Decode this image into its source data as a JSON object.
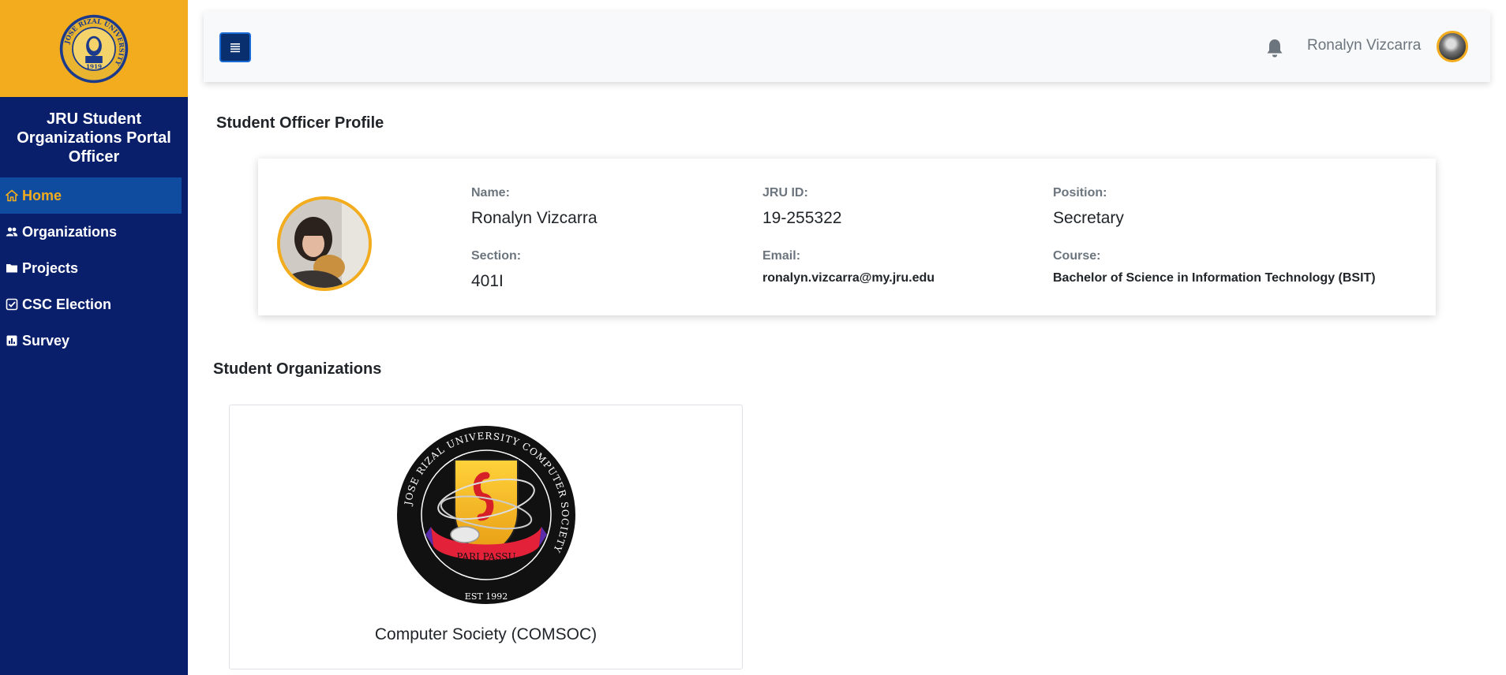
{
  "sidebar": {
    "seal_text": "JOSE RIZAL UNIVERSITY",
    "seal_year": "1919",
    "title": "JRU Student Organizations Portal Officer",
    "items": [
      {
        "label": "Home",
        "icon": "home-icon",
        "active": true
      },
      {
        "label": "Organizations",
        "icon": "users-icon",
        "active": false
      },
      {
        "label": "Projects",
        "icon": "folder-icon",
        "active": false
      },
      {
        "label": "CSC Election",
        "icon": "checkbox-icon",
        "active": false
      },
      {
        "label": "Survey",
        "icon": "poll-icon",
        "active": false
      }
    ]
  },
  "topbar": {
    "menu_icon": "list-icon",
    "bell_icon": "bell-icon",
    "username": "Ronalyn Vizcarra"
  },
  "profile": {
    "heading": "Student Officer Profile",
    "name_label": "Name:",
    "name": "Ronalyn Vizcarra",
    "jru_id_label": "JRU ID:",
    "jru_id": "19-255322",
    "position_label": "Position:",
    "position": "Secretary",
    "section_label": "Section:",
    "section": "401I",
    "email_label": "Email:",
    "email": "ronalyn.vizcarra@my.jru.edu",
    "course_label": "Course:",
    "course": "Bachelor of Science in Information Technology (BSIT)"
  },
  "organizations": {
    "heading": "Student Organizations",
    "items": [
      {
        "name": "Computer Society (COMSOC)",
        "logo_text": "JOSE RIZAL UNIVERSITY COMPUTER SOCIETY",
        "logo_motto": "PARI PASSU",
        "logo_est": "EST 1992"
      }
    ]
  },
  "colors": {
    "sidebar_bg": "#0a1f6b",
    "brand_gold": "#f2ac1d",
    "active_bg": "#0f4ca0"
  }
}
